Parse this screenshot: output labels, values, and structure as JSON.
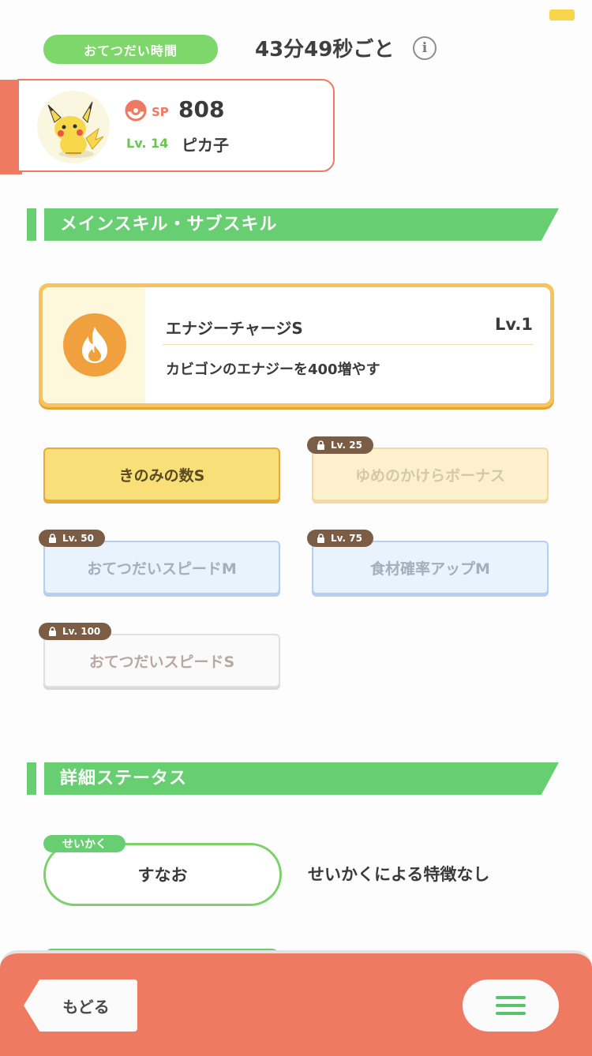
{
  "help": {
    "label": "おてつだい時間",
    "time": "43分49秒ごと",
    "info_glyph": "i"
  },
  "pokemon": {
    "sp_label": "SP",
    "sp_value": "808",
    "level": "Lv. 14",
    "name": "ピカ子",
    "accent_color": "#ef7a62"
  },
  "sections": {
    "skills_title": "メインスキル・サブスキル",
    "status_title": "詳細ステータス"
  },
  "main_skill": {
    "name": "エナジーチャージS",
    "level": "Lv.1",
    "description": "カビゴンのエナジーを400増やす",
    "icon": "flame-icon",
    "color": "#f1a03e"
  },
  "sub_skills": [
    {
      "label": "きのみの数S",
      "lock": ""
    },
    {
      "label": "ゆめのかけらボーナス",
      "lock": "Lv. 25"
    },
    {
      "label": "おてつだいスピードM",
      "lock": "Lv. 50"
    },
    {
      "label": "食材確率アップM",
      "lock": "Lv. 75"
    },
    {
      "label": "おてつだいスピードS",
      "lock": "Lv. 100"
    }
  ],
  "nature": {
    "tag": "せいかく",
    "value": "すなお",
    "description": "せいかくによる特徴なし"
  },
  "footer": {
    "back_label": "もどる",
    "menu_icon": "hamburger-menu-icon"
  },
  "colors": {
    "green": "#67cf71",
    "gold": "#f8df77",
    "brown": "#7a5d44"
  }
}
